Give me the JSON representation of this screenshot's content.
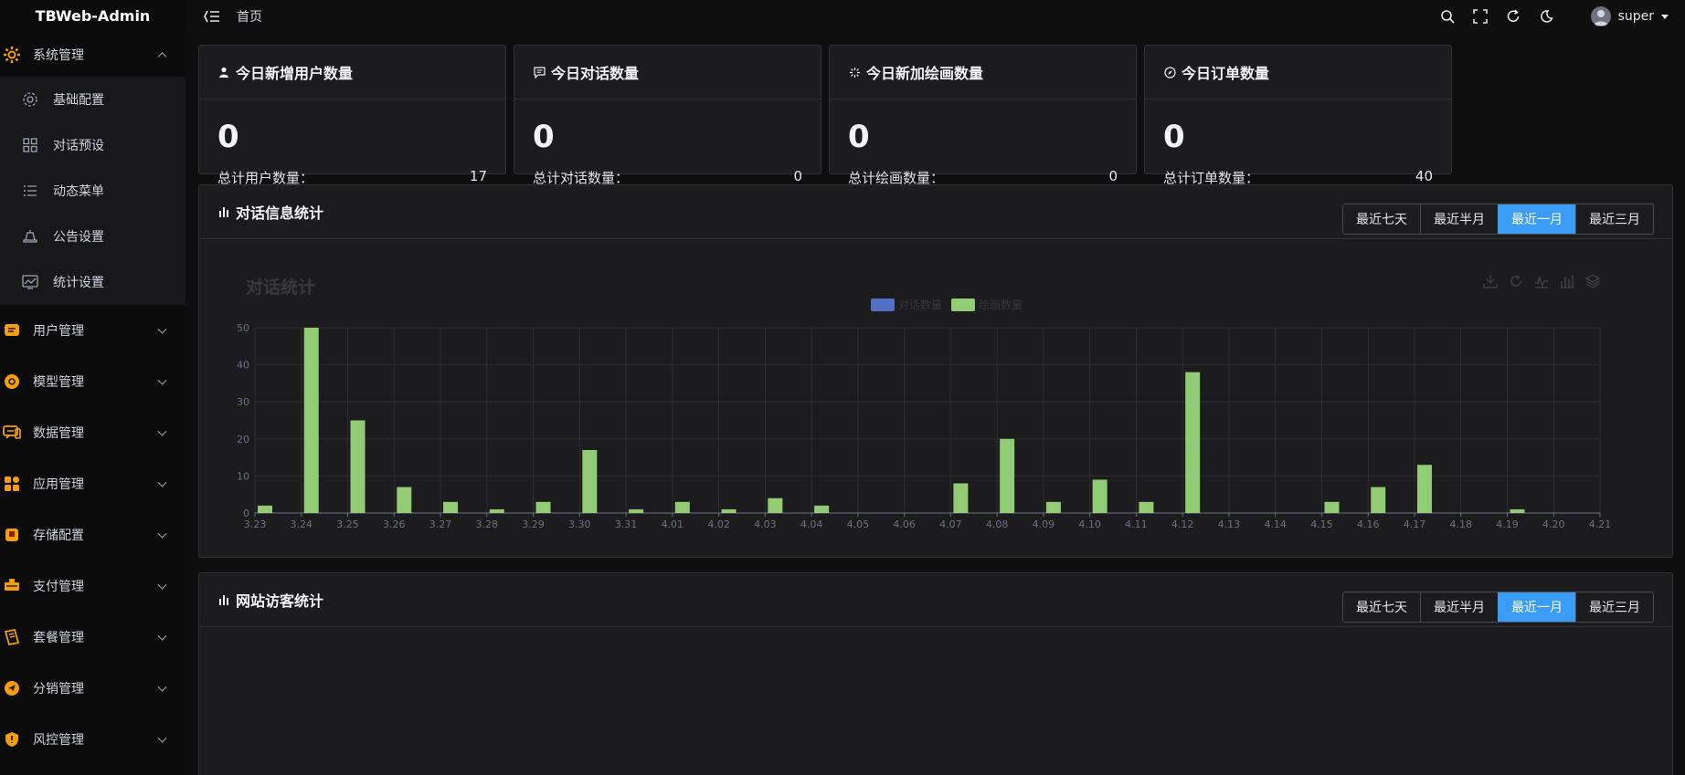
{
  "app": {
    "title": "TBWeb-Admin"
  },
  "sidebar": {
    "groups": [
      {
        "label": "系统管理",
        "icon": "gear-icon",
        "color": "#f59e0b",
        "expanded": true,
        "items": [
          {
            "label": "基础配置",
            "icon": "settings-icon"
          },
          {
            "label": "对话预设",
            "icon": "grid-icon"
          },
          {
            "label": "动态菜单",
            "icon": "list-icon"
          },
          {
            "label": "公告设置",
            "icon": "megaphone-icon"
          },
          {
            "label": "统计设置",
            "icon": "chart-monitor-icon"
          }
        ]
      },
      {
        "label": "用户管理",
        "icon": "user-card-icon",
        "color": "#f59e0b"
      },
      {
        "label": "模型管理",
        "icon": "model-icon",
        "color": "#f59e0b"
      },
      {
        "label": "数据管理",
        "icon": "chat-data-icon",
        "color": "#f59e0b"
      },
      {
        "label": "应用管理",
        "icon": "apps-icon",
        "color": "#f59e0b"
      },
      {
        "label": "存储配置",
        "icon": "storage-icon",
        "color": "#f59e0b"
      },
      {
        "label": "支付管理",
        "icon": "payment-icon",
        "color": "#f59e0b"
      },
      {
        "label": "套餐管理",
        "icon": "package-icon",
        "color": "#f59e0b"
      },
      {
        "label": "分销管理",
        "icon": "distribution-icon",
        "color": "#f59e0b"
      },
      {
        "label": "风控管理",
        "icon": "shield-icon",
        "color": "#f59e0b"
      }
    ]
  },
  "header": {
    "breadcrumb": "首页",
    "user": "super",
    "tools": [
      "search-icon",
      "fullscreen-icon",
      "refresh-icon",
      "dark-mode-icon"
    ]
  },
  "stats": [
    {
      "title": "今日新增用户数量",
      "icon": "user-icon",
      "today": "0",
      "total_label": "总计用户数量：",
      "total": "17"
    },
    {
      "title": "今日对话数量",
      "icon": "chat-icon",
      "today": "0",
      "total_label": "总计对话数量：",
      "total": "0"
    },
    {
      "title": "今日新加绘画数量",
      "icon": "sparkle-icon",
      "today": "0",
      "total_label": "总计绘画数量：",
      "total": "0"
    },
    {
      "title": "今日订单数量",
      "icon": "compass-icon",
      "today": "0",
      "total_label": "总计订单数量：",
      "total": "40"
    }
  ],
  "chat_panel": {
    "title": "对话信息统计",
    "ranges": [
      "最近七天",
      "最近半月",
      "最近一月",
      "最近三月"
    ],
    "active_range": 2
  },
  "visitor_panel": {
    "title": "网站访客统计",
    "ranges": [
      "最近七天",
      "最近半月",
      "最近一月",
      "最近三月"
    ],
    "active_range": 2
  },
  "chart_data": {
    "type": "bar",
    "title": "对话统计",
    "categories": [
      "3.23",
      "3.24",
      "3.25",
      "3.26",
      "3.27",
      "3.28",
      "3.29",
      "3.30",
      "3.31",
      "4.01",
      "4.02",
      "4.03",
      "4.04",
      "4.05",
      "4.06",
      "4.07",
      "4.08",
      "4.09",
      "4.10",
      "4.11",
      "4.12",
      "4.13",
      "4.14",
      "4.15",
      "4.16",
      "4.17",
      "4.18",
      "4.19",
      "4.20",
      "4.21"
    ],
    "series": [
      {
        "name": "对话数量",
        "color": "#5470c6",
        "values": [
          0,
          0,
          0,
          0,
          0,
          0,
          0,
          0,
          0,
          0,
          0,
          0,
          0,
          0,
          0,
          0,
          0,
          0,
          0,
          0,
          0,
          0,
          0,
          0,
          0,
          0,
          0,
          0,
          0,
          0
        ]
      },
      {
        "name": "绘画数量",
        "color": "#91cc75",
        "values": [
          2,
          50,
          25,
          7,
          3,
          1,
          3,
          17,
          1,
          3,
          1,
          4,
          2,
          0,
          0,
          8,
          20,
          3,
          9,
          3,
          38,
          0,
          0,
          3,
          7,
          13,
          0,
          1,
          0,
          0
        ]
      }
    ],
    "ylim": [
      0,
      50
    ],
    "yticks": [
      0,
      10,
      20,
      30,
      40,
      50
    ],
    "grid": true,
    "legend": "top-center"
  }
}
